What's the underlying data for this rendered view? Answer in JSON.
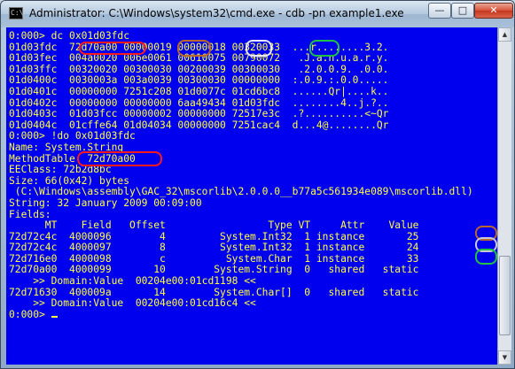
{
  "window": {
    "title": "Administrator: C:\\Windows\\system32\\cmd.exe - cdb  -pn example1.exe",
    "icon": "cmd-icon",
    "icon_glyph": "C:\\",
    "buttons": {
      "minimize": "—",
      "maximize": "□",
      "close": "✕"
    }
  },
  "console": {
    "fg_color": "#ffff44",
    "bg_color": "#0000ee",
    "lines": [
      "0:000> dc 0x01d03fdc",
      "01d03fdc  72d70a00 00000019 00000018 00320033  ...r........3.2.",
      "01d03fec  004a0020 006e0061 00610075 00790072   .J.a.n.u.a.r.y.",
      "01d03ffc  00320020 00300030 00200039 00300030   .2.0.0.9. .0.0.",
      "01d0400c  0030003a 003a0039 00300030 00000000  :.0.9.:.0.0.....",
      "01d0401c  00000000 7251c208 01d0077c 01cd6bc8  ......Qr|....k..",
      "01d0402c  00000000 00000000 6aa49434 01d03fdc  ........4..j.?..",
      "01d0403c  01d03fcc 00000002 00000000 72517e3c  .?..........<~Qr",
      "01d0404c  01cffe64 01d04034 00000000 7251cac4  d...4@........Qr",
      "0:000> !do 0x01d03fdc",
      "Name: System.String",
      "MethodTable: 72d70a00",
      "EEClass: 72b2d8bc",
      "Size: 66(0x42) bytes",
      " (C:\\Windows\\assembly\\GAC_32\\mscorlib\\2.0.0.0__b77a5c561934e089\\mscorlib.dll)",
      "String: 32 January 2009 00:09:00",
      "Fields:",
      "      MT    Field   Offset                 Type VT     Attr    Value",
      "72d72c4c  4000096        4         System.Int32  1 instance       25",
      "72d72c4c  4000097        8         System.Int32  1 instance       24",
      "72d716e0  4000098        c          System.Char  1 instance       33",
      "72d70a00  4000099       10        System.String  0   shared   static",
      "    >> Domain:Value  00204e00:01cd1198 <<",
      "72d71630  400009a       14        System.Char[]  0   shared   static",
      "    >> Domain:Value  00204e00:01cd16c4 <<",
      "0:000> "
    ]
  },
  "annotations": [
    {
      "name": "highlight-methodtable-dump",
      "color": "red"
    },
    {
      "name": "highlight-value-19",
      "color": "brown"
    },
    {
      "name": "highlight-value-18",
      "color": "white"
    },
    {
      "name": "highlight-value-33",
      "color": "green"
    },
    {
      "name": "highlight-methodtable-field",
      "color": "red"
    },
    {
      "name": "highlight-field-25",
      "color": "brown"
    },
    {
      "name": "highlight-field-24",
      "color": "grey"
    },
    {
      "name": "highlight-field-33",
      "color": "green"
    }
  ]
}
